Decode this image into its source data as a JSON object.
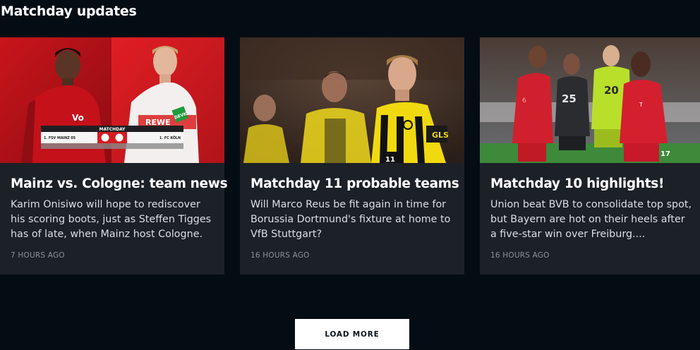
{
  "section": {
    "title": "Matchday updates"
  },
  "cards": [
    {
      "title": "Mainz vs. Cologne: team news",
      "description": "Karim Onisiwo will hope to rediscover his scoring boots, just as Steffen Tigges has of late, when Mainz host Cologne.",
      "time": "7 HOURS AGO",
      "image": {
        "banner_header": "MATCHDAY",
        "home_team": "1. FSV MAINZ 05",
        "away_team": "1. FC KÖLN",
        "sponsor_left": "Vo",
        "sponsor_right": "DEVK",
        "shirt_word": "REWE"
      }
    },
    {
      "title": "Matchday 11 probable teams",
      "description": "Will Marco Reus be fit again in time for Borussia Dortmund's fixture at home to VfB Stuttgart?",
      "time": "16 HOURS AGO",
      "image": {
        "shirt_number": "11",
        "shirt_word": "GLS"
      }
    },
    {
      "title": "Matchday 10 highlights!",
      "description": "Union beat BVB to consolidate top spot, but Bayern are hot on their heels after a five-star win over Freiburg....",
      "time": "16 HOURS AGO",
      "image": {
        "number_a": "25",
        "number_b": "20",
        "number_c": "17"
      }
    }
  ],
  "load_more": {
    "label": "LOAD MORE"
  }
}
